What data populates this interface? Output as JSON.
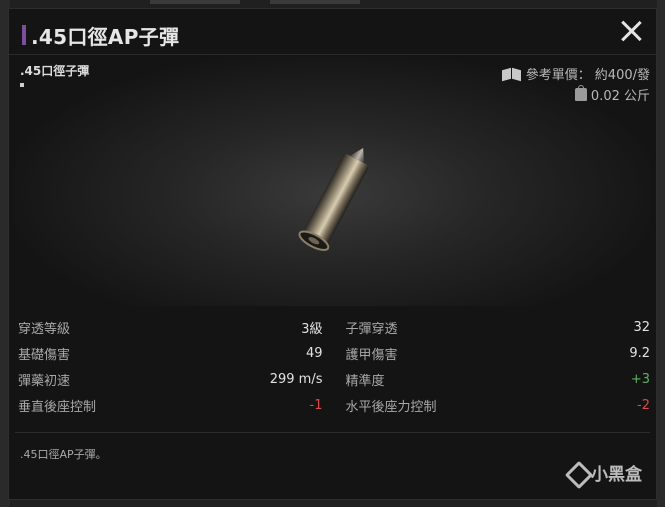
{
  "dialog": {
    "title": ".45口徑AP子彈",
    "close_icon": "close-icon"
  },
  "preview": {
    "item_name": ".45口徑子彈",
    "price_label": "參考單價：",
    "price_value": "約400/發",
    "weight": "0.02 公斤",
    "icons": {
      "price": "book-icon",
      "weight": "weight-icon"
    }
  },
  "stats": [
    {
      "left_label": "穿透等級",
      "left_value": "3級",
      "left_tone": "",
      "right_label": "子彈穿透",
      "right_value": "32",
      "right_tone": ""
    },
    {
      "left_label": "基礎傷害",
      "left_value": "49",
      "left_tone": "",
      "right_label": "護甲傷害",
      "right_value": "9.2",
      "right_tone": ""
    },
    {
      "left_label": "彈藥初速",
      "left_value": "299 m/s",
      "left_tone": "",
      "right_label": "精準度",
      "right_value": "+3",
      "right_tone": "pos"
    },
    {
      "left_label": "垂直後座控制",
      "left_value": "-1",
      "left_tone": "neg",
      "right_label": "水平後座力控制",
      "right_value": "-2",
      "right_tone": "neg"
    }
  ],
  "description": ".45口徑AP子彈。",
  "watermark": "小黑盒",
  "colors": {
    "accent": "#7b4f9c",
    "positive": "#5fb35f",
    "negative": "#d94a4a"
  }
}
